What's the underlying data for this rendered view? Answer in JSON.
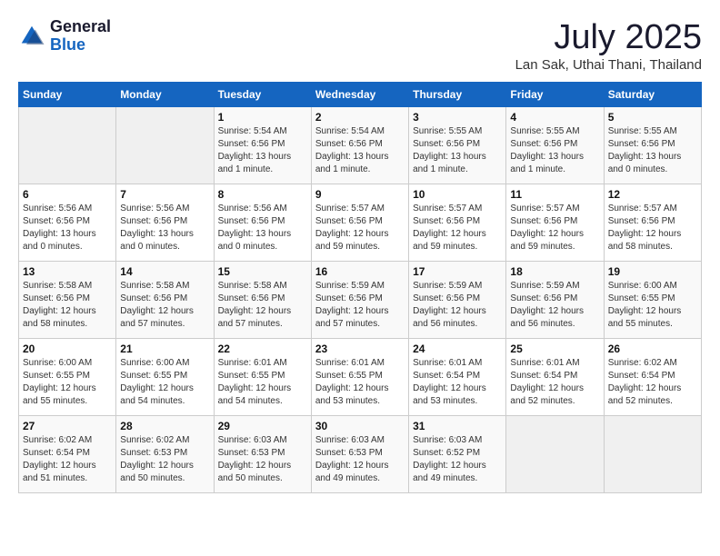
{
  "header": {
    "logo_line1": "General",
    "logo_line2": "Blue",
    "month_title": "July 2025",
    "location": "Lan Sak, Uthai Thani, Thailand"
  },
  "weekdays": [
    "Sunday",
    "Monday",
    "Tuesday",
    "Wednesday",
    "Thursday",
    "Friday",
    "Saturday"
  ],
  "weeks": [
    [
      {
        "day": "",
        "empty": true
      },
      {
        "day": "",
        "empty": true
      },
      {
        "day": "1",
        "sunrise": "5:54 AM",
        "sunset": "6:56 PM",
        "daylight": "13 hours and 1 minute."
      },
      {
        "day": "2",
        "sunrise": "5:54 AM",
        "sunset": "6:56 PM",
        "daylight": "13 hours and 1 minute."
      },
      {
        "day": "3",
        "sunrise": "5:55 AM",
        "sunset": "6:56 PM",
        "daylight": "13 hours and 1 minute."
      },
      {
        "day": "4",
        "sunrise": "5:55 AM",
        "sunset": "6:56 PM",
        "daylight": "13 hours and 1 minute."
      },
      {
        "day": "5",
        "sunrise": "5:55 AM",
        "sunset": "6:56 PM",
        "daylight": "13 hours and 0 minutes."
      }
    ],
    [
      {
        "day": "6",
        "sunrise": "5:56 AM",
        "sunset": "6:56 PM",
        "daylight": "13 hours and 0 minutes."
      },
      {
        "day": "7",
        "sunrise": "5:56 AM",
        "sunset": "6:56 PM",
        "daylight": "13 hours and 0 minutes."
      },
      {
        "day": "8",
        "sunrise": "5:56 AM",
        "sunset": "6:56 PM",
        "daylight": "13 hours and 0 minutes."
      },
      {
        "day": "9",
        "sunrise": "5:57 AM",
        "sunset": "6:56 PM",
        "daylight": "12 hours and 59 minutes."
      },
      {
        "day": "10",
        "sunrise": "5:57 AM",
        "sunset": "6:56 PM",
        "daylight": "12 hours and 59 minutes."
      },
      {
        "day": "11",
        "sunrise": "5:57 AM",
        "sunset": "6:56 PM",
        "daylight": "12 hours and 59 minutes."
      },
      {
        "day": "12",
        "sunrise": "5:57 AM",
        "sunset": "6:56 PM",
        "daylight": "12 hours and 58 minutes."
      }
    ],
    [
      {
        "day": "13",
        "sunrise": "5:58 AM",
        "sunset": "6:56 PM",
        "daylight": "12 hours and 58 minutes."
      },
      {
        "day": "14",
        "sunrise": "5:58 AM",
        "sunset": "6:56 PM",
        "daylight": "12 hours and 57 minutes."
      },
      {
        "day": "15",
        "sunrise": "5:58 AM",
        "sunset": "6:56 PM",
        "daylight": "12 hours and 57 minutes."
      },
      {
        "day": "16",
        "sunrise": "5:59 AM",
        "sunset": "6:56 PM",
        "daylight": "12 hours and 57 minutes."
      },
      {
        "day": "17",
        "sunrise": "5:59 AM",
        "sunset": "6:56 PM",
        "daylight": "12 hours and 56 minutes."
      },
      {
        "day": "18",
        "sunrise": "5:59 AM",
        "sunset": "6:56 PM",
        "daylight": "12 hours and 56 minutes."
      },
      {
        "day": "19",
        "sunrise": "6:00 AM",
        "sunset": "6:55 PM",
        "daylight": "12 hours and 55 minutes."
      }
    ],
    [
      {
        "day": "20",
        "sunrise": "6:00 AM",
        "sunset": "6:55 PM",
        "daylight": "12 hours and 55 minutes."
      },
      {
        "day": "21",
        "sunrise": "6:00 AM",
        "sunset": "6:55 PM",
        "daylight": "12 hours and 54 minutes."
      },
      {
        "day": "22",
        "sunrise": "6:01 AM",
        "sunset": "6:55 PM",
        "daylight": "12 hours and 54 minutes."
      },
      {
        "day": "23",
        "sunrise": "6:01 AM",
        "sunset": "6:55 PM",
        "daylight": "12 hours and 53 minutes."
      },
      {
        "day": "24",
        "sunrise": "6:01 AM",
        "sunset": "6:54 PM",
        "daylight": "12 hours and 53 minutes."
      },
      {
        "day": "25",
        "sunrise": "6:01 AM",
        "sunset": "6:54 PM",
        "daylight": "12 hours and 52 minutes."
      },
      {
        "day": "26",
        "sunrise": "6:02 AM",
        "sunset": "6:54 PM",
        "daylight": "12 hours and 52 minutes."
      }
    ],
    [
      {
        "day": "27",
        "sunrise": "6:02 AM",
        "sunset": "6:54 PM",
        "daylight": "12 hours and 51 minutes."
      },
      {
        "day": "28",
        "sunrise": "6:02 AM",
        "sunset": "6:53 PM",
        "daylight": "12 hours and 50 minutes."
      },
      {
        "day": "29",
        "sunrise": "6:03 AM",
        "sunset": "6:53 PM",
        "daylight": "12 hours and 50 minutes."
      },
      {
        "day": "30",
        "sunrise": "6:03 AM",
        "sunset": "6:53 PM",
        "daylight": "12 hours and 49 minutes."
      },
      {
        "day": "31",
        "sunrise": "6:03 AM",
        "sunset": "6:52 PM",
        "daylight": "12 hours and 49 minutes."
      },
      {
        "day": "",
        "empty": true
      },
      {
        "day": "",
        "empty": true
      }
    ]
  ]
}
